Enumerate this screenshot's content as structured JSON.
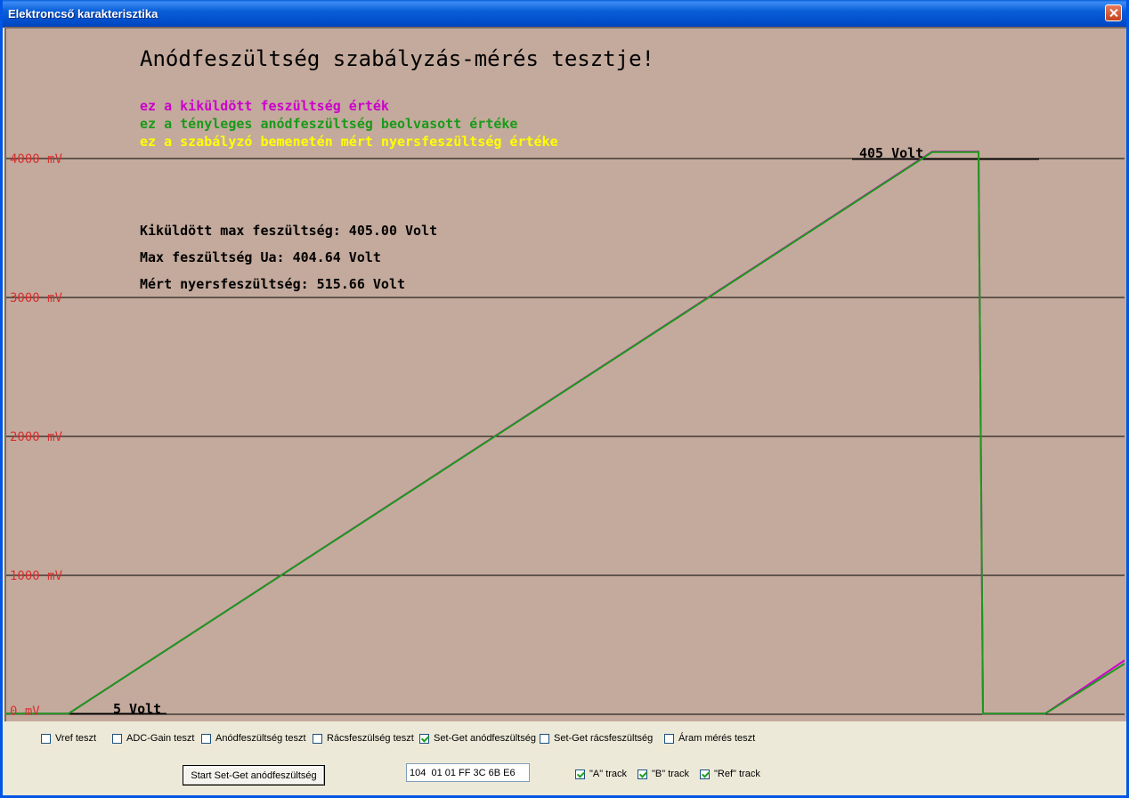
{
  "window": {
    "title": "Elektroncső karakterisztika"
  },
  "plot": {
    "title": "Anódfeszültség szabályzás-mérés tesztje!",
    "legend": [
      {
        "text": "ez a kiküldött feszültség érték",
        "color": "#cc00cc"
      },
      {
        "text": "ez a tényleges anódfeszültség beolvasott értéke",
        "color": "#1a9a1a"
      },
      {
        "text": "ez a szabályzó bemenetén mért nyersfeszültség értéke",
        "color": "#ffff00"
      }
    ],
    "info": [
      "Kiküldött max feszültség: 405.00 Volt",
      "Max feszültség Ua: 404.64 Volt",
      "Mért nyersfeszültség: 515.66 Volt"
    ],
    "y_labels": [
      "4000 mV",
      "3000 mV",
      "2000 mV",
      "1000 mV",
      "0 mV"
    ],
    "annotations": {
      "max": "405 Volt",
      "min": "5 Volt"
    },
    "colors": {
      "background": "#c4aa9c",
      "sent": "#cc00cc",
      "actual": "#1a9a1a",
      "raw": "#ffff00",
      "axis_label": "#d83030"
    }
  },
  "chart_data": {
    "type": "line",
    "ylim": [
      0,
      4000
    ],
    "yticks": [
      0,
      1000,
      2000,
      3000,
      4000
    ],
    "y_unit": "mV",
    "grid": true,
    "series": [
      {
        "name": "ez a kiküldött feszültség érték",
        "x": [
          0,
          70,
          1040,
          1092,
          1097,
          1167,
          1260
        ],
        "values": [
          5,
          5,
          4050,
          4050,
          5,
          5,
          405
        ]
      },
      {
        "name": "ez a tényleges anódfeszültség beolvasott értéke",
        "x": [
          0,
          70,
          1040,
          1092,
          1097,
          1167,
          1260
        ],
        "values": [
          5,
          5,
          4046,
          4046,
          5,
          5,
          380
        ]
      }
    ]
  },
  "controls": {
    "checkboxes": [
      {
        "label": "Vref teszt",
        "checked": false
      },
      {
        "label": "ADC-Gain teszt",
        "checked": false
      },
      {
        "label": "Anódfeszültség teszt",
        "checked": false
      },
      {
        "label": "Rácsfeszülség teszt",
        "checked": false
      },
      {
        "label": "Set-Get anódfeszültség",
        "checked": true
      },
      {
        "label": "Set-Get rácsfeszültség",
        "checked": false
      },
      {
        "label": "Áram mérés teszt",
        "checked": false
      }
    ],
    "start_button": "Start Set-Get anódfeszültség",
    "hex_value": "104  01 01 FF 3C 6B E6",
    "tracks": [
      {
        "label": "\"A\" track",
        "checked": true
      },
      {
        "label": "\"B\" track",
        "checked": true
      },
      {
        "label": "\"Ref\" track",
        "checked": true
      }
    ]
  }
}
